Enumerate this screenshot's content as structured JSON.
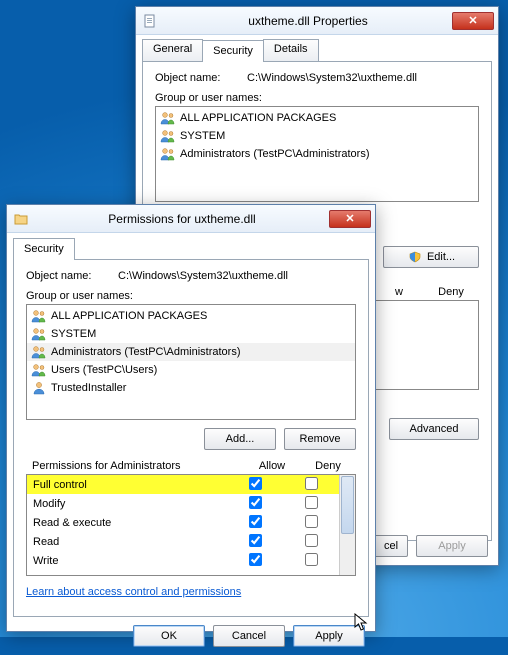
{
  "propWin": {
    "title": "uxtheme.dll Properties",
    "tabs": {
      "general": "General",
      "security": "Security",
      "details": "Details"
    },
    "objectNameLabel": "Object name:",
    "objectName": "C:\\Windows\\System32\\uxtheme.dll",
    "groupLabel": "Group or user names:",
    "entries": [
      "ALL APPLICATION PACKAGES",
      "SYSTEM",
      "Administrators (TestPC\\Administrators)"
    ],
    "editBtn": "Edit...",
    "allowHdr": "w",
    "denyHdr": "Deny",
    "advancedBtn": "Advanced",
    "cancelBtnFrag": "cel",
    "applyBtn": "Apply"
  },
  "permWin": {
    "title": "Permissions for uxtheme.dll",
    "tab": "Security",
    "objectNameLabel": "Object name:",
    "objectName": "C:\\Windows\\System32\\uxtheme.dll",
    "groupLabel": "Group or user names:",
    "entries": [
      "ALL APPLICATION PACKAGES",
      "SYSTEM",
      "Administrators (TestPC\\Administrators)",
      "Users (TestPC\\Users)",
      "TrustedInstaller"
    ],
    "selectedEntryIndex": 2,
    "addBtn": "Add...",
    "removeBtn": "Remove",
    "permForLabel": "Permissions for Administrators",
    "allowHdr": "Allow",
    "denyHdr": "Deny",
    "perms": [
      {
        "name": "Full control",
        "allow": true,
        "deny": false,
        "hi": true
      },
      {
        "name": "Modify",
        "allow": true,
        "deny": false,
        "hi": false
      },
      {
        "name": "Read & execute",
        "allow": true,
        "deny": false,
        "hi": false
      },
      {
        "name": "Read",
        "allow": true,
        "deny": false,
        "hi": false
      },
      {
        "name": "Write",
        "allow": true,
        "deny": false,
        "hi": false
      }
    ],
    "learnLink": "Learn about access control and permissions",
    "okBtn": "OK",
    "cancelBtn": "Cancel",
    "applyBtn": "Apply"
  }
}
